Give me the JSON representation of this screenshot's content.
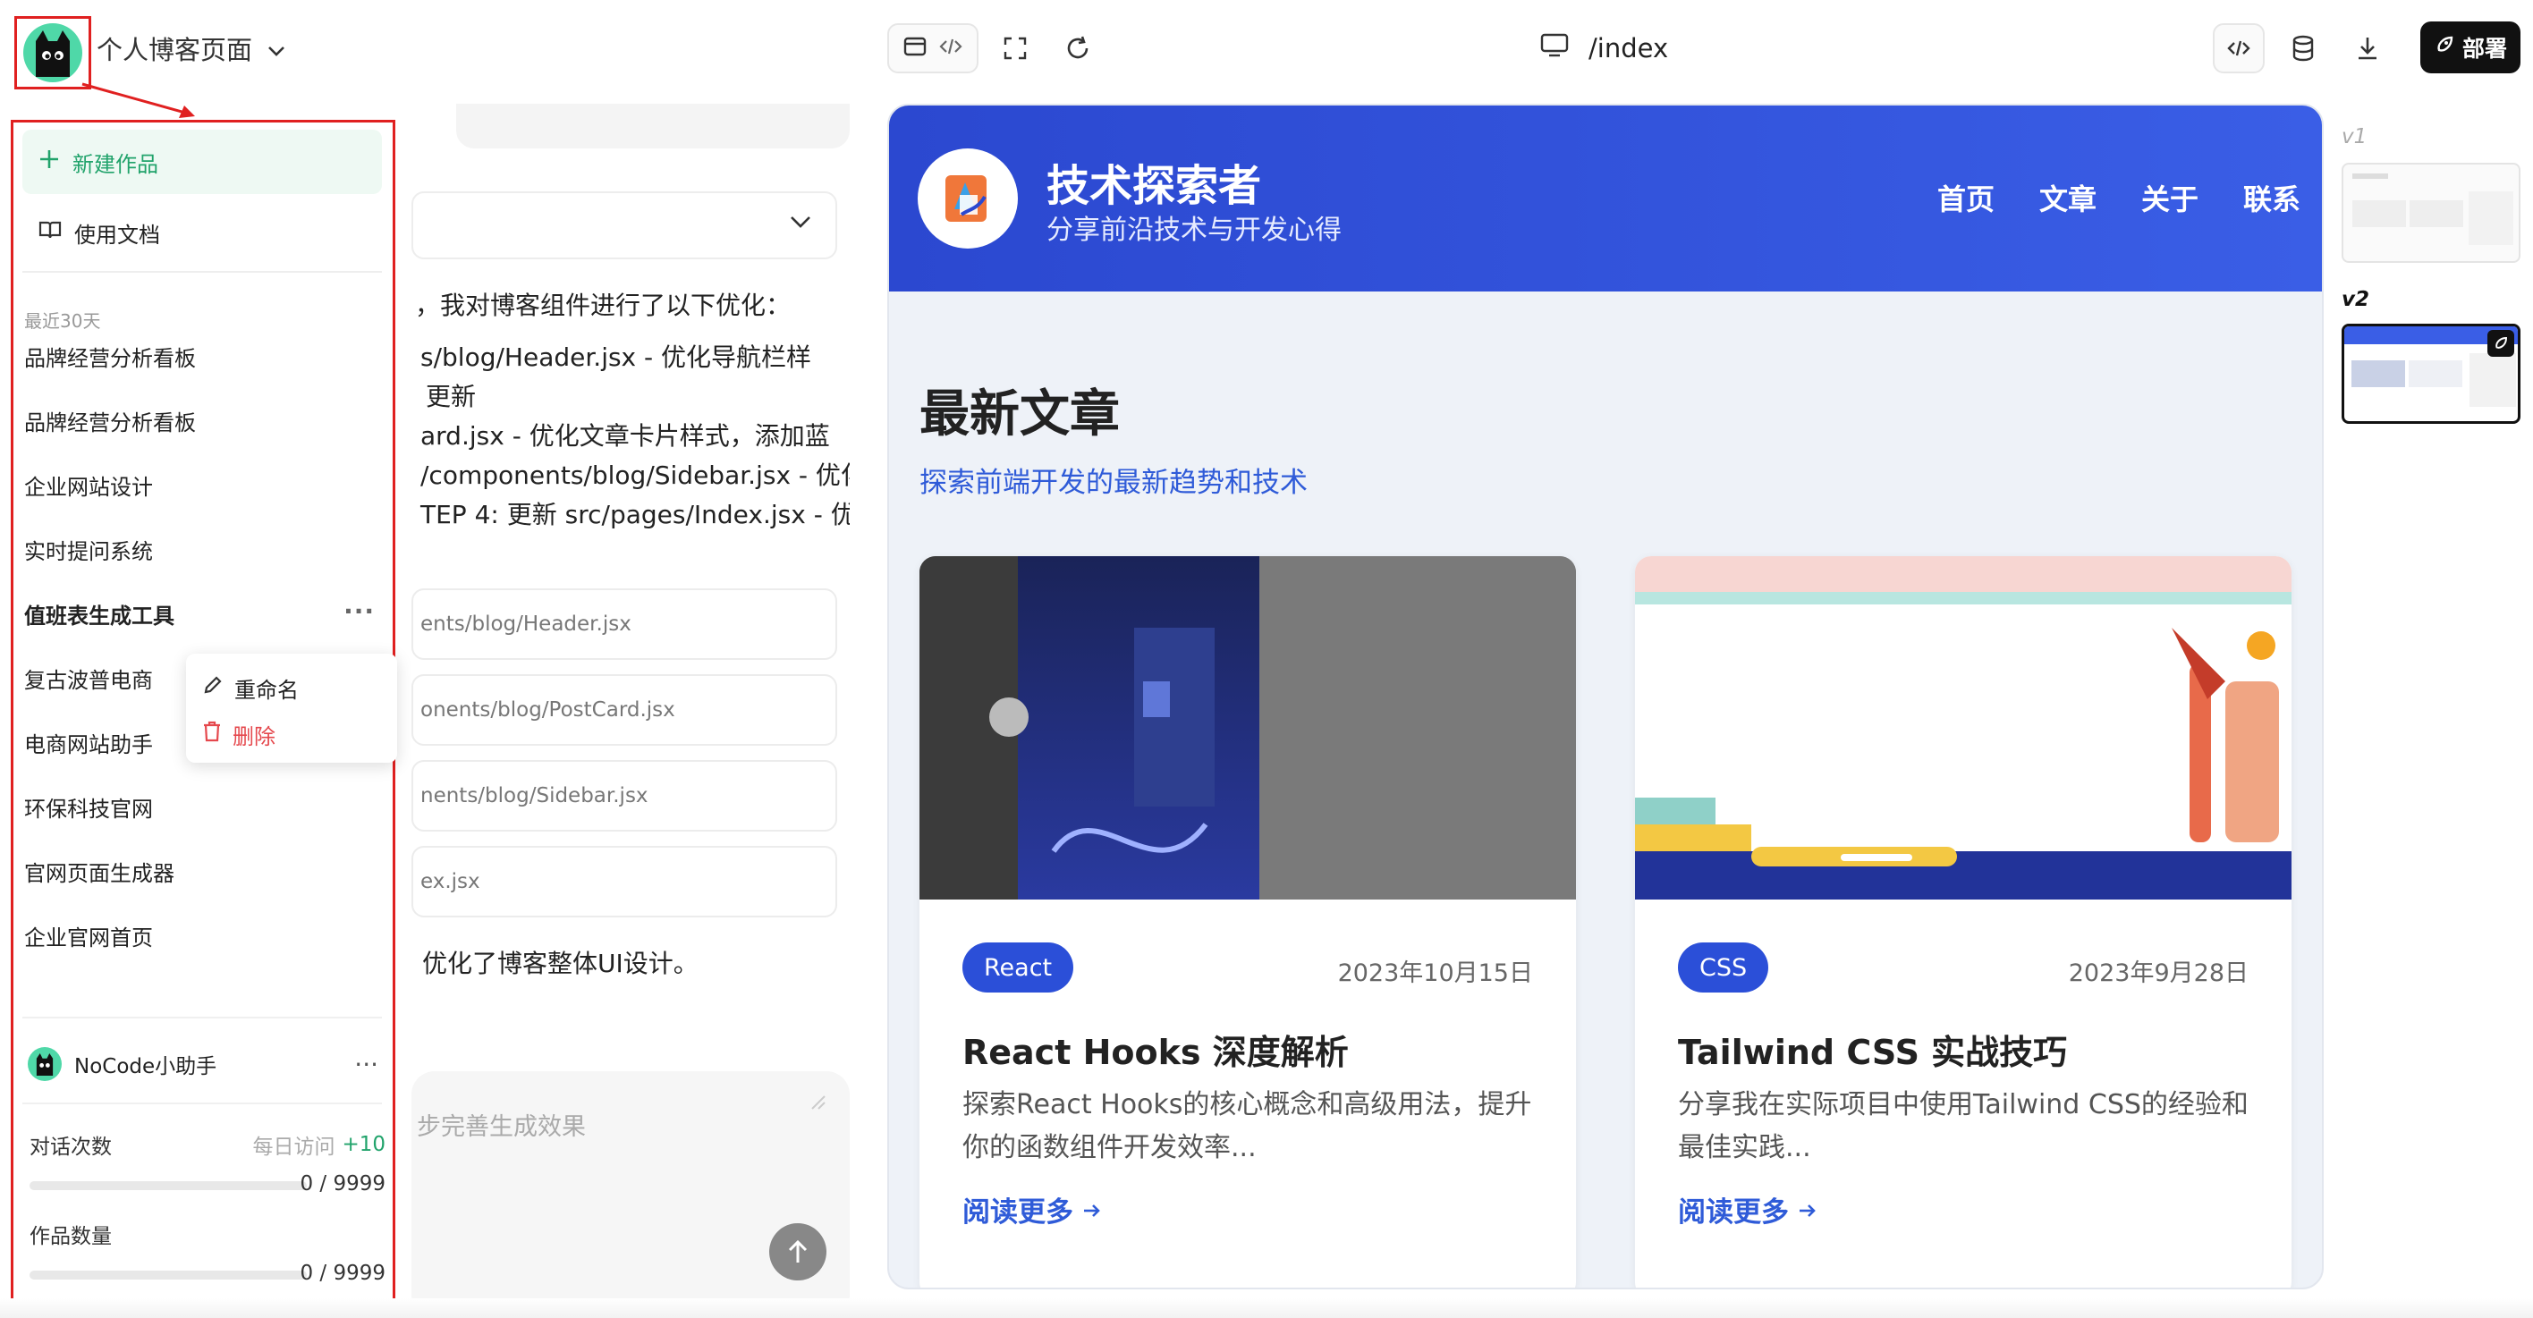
{
  "header": {
    "project_title": "个人博客页面",
    "path": "/index",
    "deploy_label": "部署"
  },
  "sidebar": {
    "new_work": "新建作品",
    "docs": "使用文档",
    "section_label": "最近30天",
    "items": [
      "品牌经营分析看板",
      "品牌经营分析看板",
      "企业网站设计",
      "实时提问系统",
      "值班表生成工具",
      "复古波普电商",
      "电商网站助手",
      "环保科技官网",
      "官网页面生成器",
      "企业官网首页"
    ],
    "context_menu": {
      "rename": "重命名",
      "delete": "删除"
    },
    "assistant_name": "NoCode小助手",
    "stats": {
      "chats_label": "对话次数",
      "daily_visit": "每日访问",
      "daily_bonus": "+10",
      "chats_value": "0 / 9999",
      "works_label": "作品数量",
      "works_value": "0 / 9999"
    }
  },
  "chat": {
    "intro": "，我对博客组件进行了以下优化：",
    "lines": [
      "s/blog/Header.jsx - 优化导航栏样",
      "更新",
      "ard.jsx - 优化文章卡片样式，添加蓝",
      "/components/blog/Sidebar.jsx - 优化",
      "TEP 4: 更新 src/pages/Index.jsx - 优"
    ],
    "files": [
      "ents/blog/Header.jsx",
      "onents/blog/PostCard.jsx",
      "nents/blog/Sidebar.jsx",
      "ex.jsx"
    ],
    "summary": "优化了博客整体UI设计。",
    "input_placeholder": "步完善生成效果"
  },
  "preview": {
    "site_title": "技术探索者",
    "site_subtitle": "分享前沿技术与开发心得",
    "nav": [
      "首页",
      "文章",
      "关于",
      "联系"
    ],
    "section_title": "最新文章",
    "section_subtitle": "探索前端开发的最新趋势和技术",
    "posts": [
      {
        "tag": "React",
        "date": "2023年10月15日",
        "title": "React Hooks 深度解析",
        "desc": "探索React Hooks的核心概念和高级用法，提升你的函数组件开发效率...",
        "more": "阅读更多"
      },
      {
        "tag": "CSS",
        "date": "2023年9月28日",
        "title": "Tailwind CSS 实战技巧",
        "desc": "分享我在实际项目中使用Tailwind CSS的经验和最佳实践...",
        "more": "阅读更多"
      }
    ]
  },
  "versions": [
    "v1",
    "v2"
  ],
  "colors": {
    "annotation_red": "#e02020",
    "brand_green": "#21a36b",
    "header_blue": "#2b48d0",
    "link_blue": "#2f5bd8"
  }
}
